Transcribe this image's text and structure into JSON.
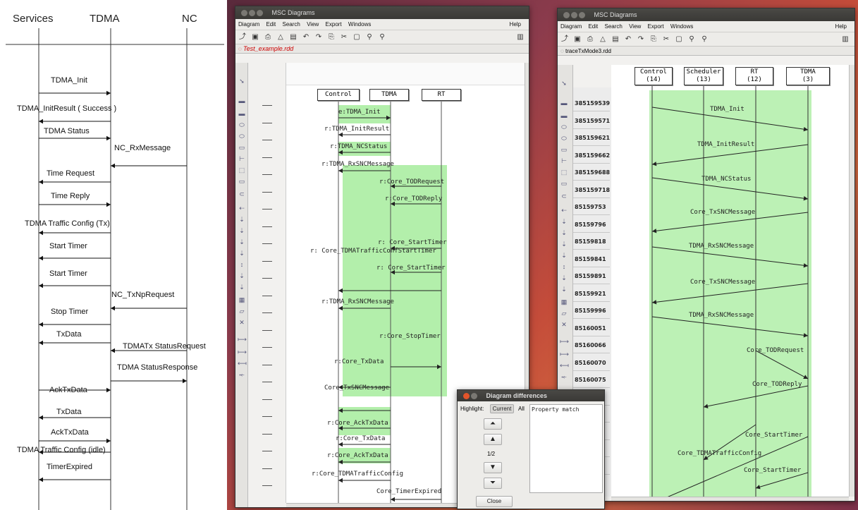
{
  "left_diagram": {
    "headers": [
      "Services",
      "TDMA",
      "NC"
    ],
    "messages": [
      "TDMA_Init",
      "TDMA_InitResult ( Success )",
      "TDMA Status",
      "NC_RxMessage",
      "Time Request",
      "Time Reply",
      "TDMA Traffic Config (Tx)",
      "Start Timer",
      "Start Timer",
      "NC_TxNpRequest",
      "Stop Timer",
      "TxData",
      "TDMATx StatusRequest",
      "TDMA StatusResponse",
      "AckTxData",
      "TxData",
      "AckTxData",
      "TDMA Traffic Config (idle)",
      "TimerExpired"
    ]
  },
  "window_a": {
    "title": "MSC Diagrams",
    "menu": [
      "Diagram",
      "Edit",
      "Search",
      "View",
      "Export",
      "Windows"
    ],
    "help": "Help",
    "tab": "Test_example.rdd",
    "lifelines": [
      "Control",
      "TDMA",
      "RT"
    ],
    "messages": [
      "e:TDMA_Init",
      "r:TDMA_InitResult",
      "r:TDMA_NCStatus",
      "r:TDMA_RxSNCMessage",
      "r:Core_TODRequest",
      "r:Core_TODReply",
      "r: Core_StartTimer",
      "r: Core_TDMATrafficConfStartTimer",
      "r: Core_StartTimer",
      "r:TDMA_RxSNCMessage",
      "r:Core_StopTimer",
      "r:Core_TxData",
      "Core_TxSNCMessage",
      "r:Core_AckTxData",
      "r:Core_TxData",
      "r:Core_AckTxData",
      "r:Core_TDMATrafficConfig",
      "Core_TimerExpired"
    ]
  },
  "window_b": {
    "title": "MSC Diagrams",
    "menu": [
      "Diagram",
      "Edit",
      "Search",
      "View",
      "Export",
      "Windows"
    ],
    "help": "Help",
    "tab": "traceTxMode3.rdd",
    "lifelines": [
      {
        "name": "Control",
        "id": "(14)"
      },
      {
        "name": "Scheduler",
        "id": "(13)"
      },
      {
        "name": "RT",
        "id": "(12)"
      },
      {
        "name": "TDMA",
        "id": "(3)"
      }
    ],
    "ids": [
      "385159539",
      "385159571",
      "385159621",
      "385159662",
      "385159688",
      "385159718",
      "85159753",
      "85159796",
      "85159818",
      "85159841",
      "85159891",
      "85159921",
      "85159996",
      "85160051",
      "85160066",
      "85160070",
      "85160075",
      "7",
      "5",
      "9",
      "5",
      "8"
    ],
    "messages": [
      "TDMA_Init",
      "TDMA_InitResult",
      "TDMA_NCStatus",
      "Core_TxSNCMessage",
      "TDMA_RxSNCMessage",
      "Core_TxSNCMessage",
      "TDMA_RxSNCMessage",
      "Core_TODRequest",
      "Core_TODReply",
      "Core_StartTimer",
      "Core_TDMATrafficConfig",
      "Core_StartTimer"
    ]
  },
  "diff_dialog": {
    "title": "Diagram differences",
    "highlight_label": "Highlight:",
    "current": "Current",
    "all": "All",
    "list_item": "Property match",
    "counter": "1/2",
    "close": "Close"
  }
}
